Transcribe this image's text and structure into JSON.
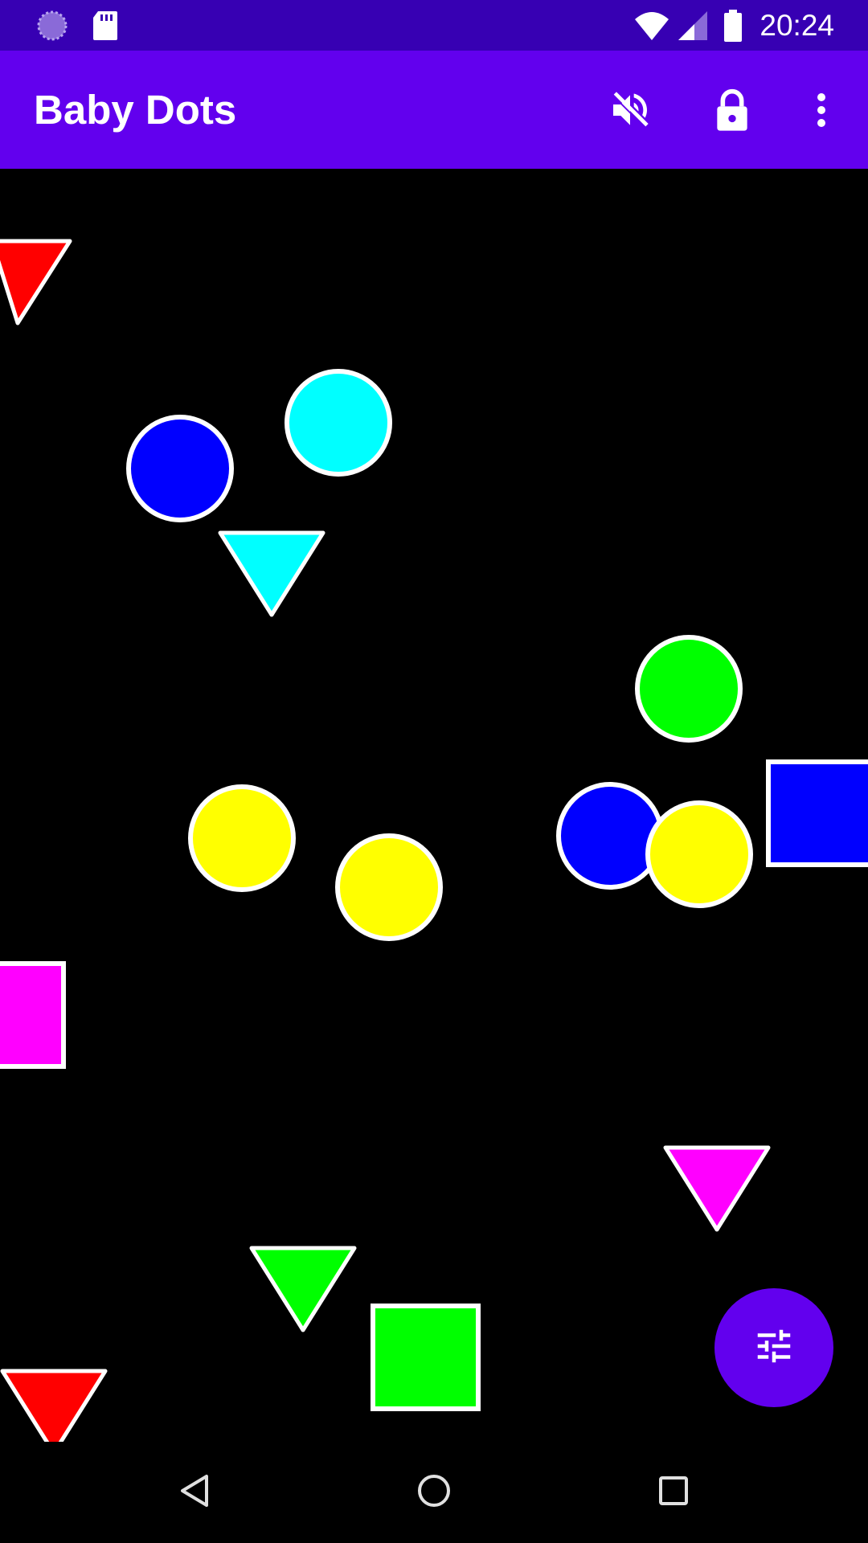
{
  "status_bar": {
    "time": "20:24",
    "icons": [
      "loading-circle-icon",
      "sd-card-icon",
      "wifi-icon",
      "cellular-signal-icon",
      "battery-icon"
    ],
    "background": "#3700B3"
  },
  "app_bar": {
    "title": "Baby Dots",
    "actions": [
      "sound-off-icon",
      "lock-icon",
      "more-vert-icon"
    ],
    "background": "#6200EE"
  },
  "canvas": {
    "background": "#000000",
    "shapes": [
      {
        "kind": "triangle",
        "color": "#FF0000"
      },
      {
        "kind": "circle",
        "color": "#0000FF"
      },
      {
        "kind": "circle",
        "color": "#00FFFF"
      },
      {
        "kind": "triangle",
        "color": "#00FFFF"
      },
      {
        "kind": "circle",
        "color": "#00FF00"
      },
      {
        "kind": "square",
        "color": "#0000FF"
      },
      {
        "kind": "circle",
        "color": "#FFFF00"
      },
      {
        "kind": "circle",
        "color": "#FFFF00"
      },
      {
        "kind": "circle",
        "color": "#0000FF"
      },
      {
        "kind": "circle",
        "color": "#FFFF00"
      },
      {
        "kind": "square",
        "color": "#FF00FF"
      },
      {
        "kind": "triangle",
        "color": "#FF00FF"
      },
      {
        "kind": "triangle",
        "color": "#00FF00"
      },
      {
        "kind": "square",
        "color": "#00FF00"
      },
      {
        "kind": "triangle",
        "color": "#FF0000"
      }
    ]
  },
  "fab": {
    "icon": "tune-icon",
    "color": "#6200EE"
  },
  "nav_bar": {
    "buttons": [
      "back-icon",
      "home-icon",
      "recents-icon"
    ]
  }
}
